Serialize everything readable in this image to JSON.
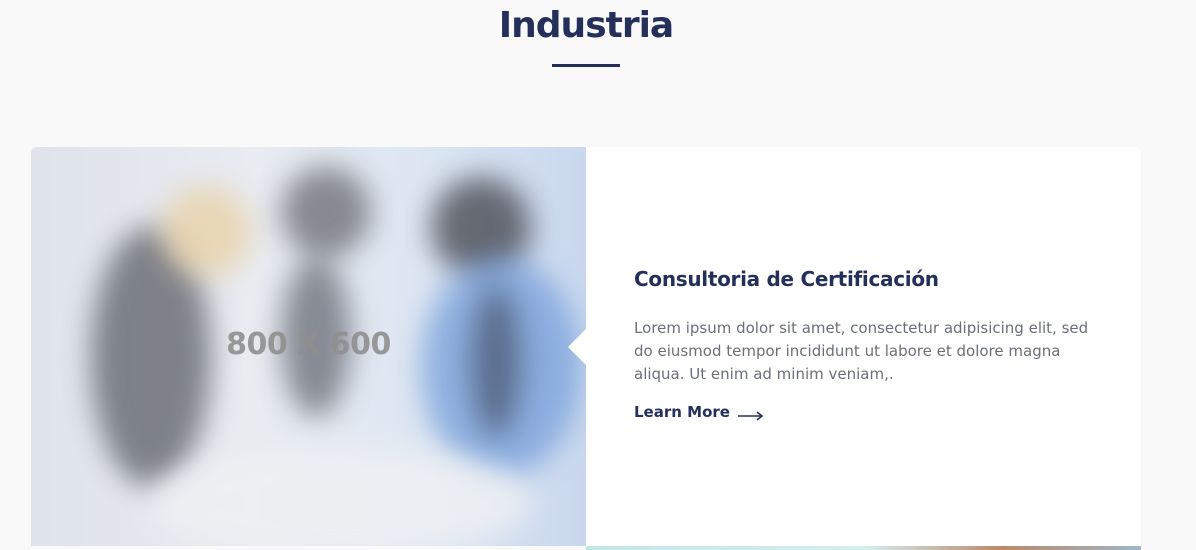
{
  "section": {
    "title": "Industria"
  },
  "card": {
    "image_placeholder": "800 X 600",
    "title": "Consultoria de Certificación",
    "description": "Lorem ipsum dolor sit amet, consectetur adipisicing elit, sed do eiusmod tempor incididunt ut labore et dolore magna aliqua. Ut enim ad minim veniam,.",
    "link_label": "Learn More",
    "link_icon": "long-arrow-right-icon"
  },
  "colors": {
    "heading": "#25305a",
    "body_text": "#6b6f7a",
    "background": "#f9f9fa",
    "card_background": "#ffffff"
  }
}
